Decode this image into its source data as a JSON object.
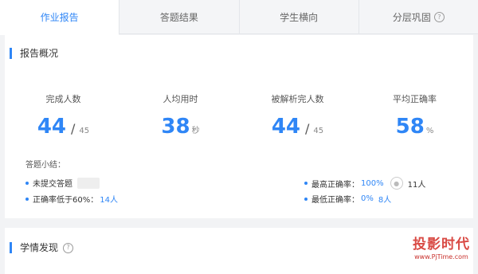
{
  "tabs": [
    {
      "label": "作业报告"
    },
    {
      "label": "答题结果"
    },
    {
      "label": "学生横向"
    },
    {
      "label": "分层巩固",
      "help_icon": "question-circle-icon"
    }
  ],
  "overview": {
    "title": "报告概况",
    "stats": [
      {
        "label": "完成人数",
        "value": "44",
        "total": "45",
        "sep": "/"
      },
      {
        "label": "人均用时",
        "value": "38",
        "unit": "秒"
      },
      {
        "label": "被解析完人数",
        "value": "44",
        "total": "45",
        "sep": "/"
      },
      {
        "label": "平均正确率",
        "value": "58",
        "unit": "%"
      }
    ],
    "summary_title": "答题小结：",
    "left_lines": [
      {
        "label": "未提交答题",
        "value": ""
      },
      {
        "label": "正确率低于60%：",
        "value": "14人"
      }
    ],
    "right_lines": [
      {
        "label": "最高正确率：",
        "value": "100%",
        "extra": "11人"
      },
      {
        "label": "最低正确率：",
        "value": "0%",
        "extra": "8人"
      }
    ]
  },
  "insights": {
    "title": "学情发现",
    "help_icon": "question-circle-icon"
  },
  "watermark": {
    "text": "投影时代",
    "url": "www.PjTime.com"
  },
  "colors": {
    "accent": "#2f86f6",
    "watermark": "#d94b45"
  }
}
